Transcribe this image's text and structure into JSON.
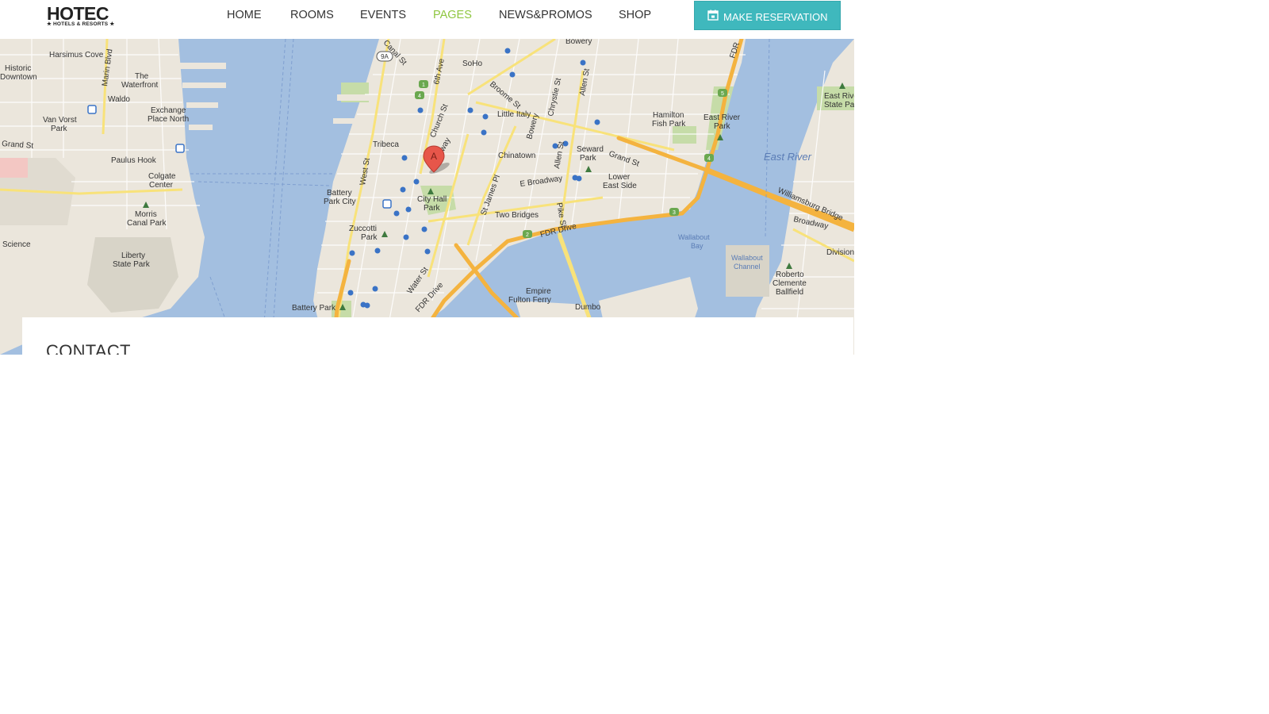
{
  "logo": {
    "name": "HOTEC",
    "tagline": "★ HOTELS & RESORTS ★"
  },
  "nav": {
    "items": [
      {
        "label": "HOME",
        "active": false
      },
      {
        "label": "ROOMS",
        "active": false
      },
      {
        "label": "EVENTS",
        "active": false
      },
      {
        "label": "PAGES",
        "active": true
      },
      {
        "label": "NEWS&PROMOS",
        "active": false
      },
      {
        "label": "SHOP",
        "active": false
      }
    ],
    "active_color": "#8ec63f"
  },
  "cta": {
    "label": "MAKE RESERVATION",
    "icon": "calendar-icon",
    "color": "#3fb8bd"
  },
  "map": {
    "marker_letter": "A",
    "places": {
      "harsimus_cove": "Harsimus Cove",
      "historic_downtown_1": "Historic",
      "historic_downtown_2": "Downtown",
      "the_waterfront_1": "The",
      "the_waterfront_2": "Waterfront",
      "waldo": "Waldo",
      "exchange_place_1": "Exchange",
      "exchange_place_2": "Place North",
      "van_vorst_1": "Van Vorst",
      "van_vorst_2": "Park",
      "paulus_hook": "Paulus Hook",
      "colgate_1": "Colgate",
      "colgate_2": "Center",
      "morris_1": "Morris",
      "morris_2": "Canal Park",
      "liberty_1": "Liberty",
      "liberty_2": "State Park",
      "science": "Science",
      "soho": "SoHo",
      "tribeca": "Tribeca",
      "little_italy": "Little Italy",
      "chinatown": "Chinatown",
      "seward_1": "Seward",
      "seward_2": "Park",
      "lower_east_1": "Lower",
      "lower_east_2": "East Side",
      "hamilton_1": "Hamilton",
      "hamilton_2": "Fish Park",
      "east_river_park_1": "East River",
      "east_river_park_2": "Park",
      "battery_1": "Battery",
      "battery_2": "Park City",
      "city_hall_1": "City Hall",
      "city_hall_2": "Park",
      "two_bridges": "Two Bridges",
      "zuccotti_1": "Zuccotti",
      "zuccotti_2": "Park",
      "wallabout_1": "Wallabout",
      "wallabout_2": "Bay",
      "wallabout_channel_1": "Wallabout",
      "wallabout_channel_2": "Channel",
      "roberto_1": "Roberto",
      "roberto_2": "Clemente",
      "roberto_3": "Ballfield",
      "east_river_top_1": "East Rive",
      "east_river_top_2": "State Pa",
      "empire_1": "Empire",
      "empire_2": "Fulton Ferry",
      "dumbo": "Dumbo",
      "battery_park": "Battery Park",
      "bowery_top": "Bowery",
      "division": "Division",
      "broadway_bk": "Broadway"
    },
    "water": {
      "east_river": "East River"
    },
    "roads": {
      "grand_st_left": "Grand St",
      "marin_blvd": "Marin Blvd",
      "canal_st": "Canal St",
      "sixth_ave": "6th Ave",
      "church_st": "Church St",
      "broadway": "Broadway",
      "broome_st": "Broome St",
      "bowery": "Bowery",
      "chrystie_st": "Chrystie St",
      "allen_st_top": "Allen St",
      "allen_st": "Allen St",
      "grand_st": "Grand St",
      "e_broadway": "E Broadway",
      "st_james_pl": "St James Pl",
      "pike_st": "Pike St",
      "fdr_drive": "FDR Drive",
      "fdr_drive_lower": "FDR Drive",
      "fdr_top": "FDR",
      "water_st": "Water St",
      "west_st": "West St",
      "williamsburg_bridge": "Williamsburg Bridge"
    },
    "shields": {
      "nine_a": "9A",
      "one": "1",
      "four_a": "4",
      "two": "2",
      "three": "3",
      "four_b": "4",
      "five": "5"
    }
  },
  "contact": {
    "title": "CONTACT"
  }
}
